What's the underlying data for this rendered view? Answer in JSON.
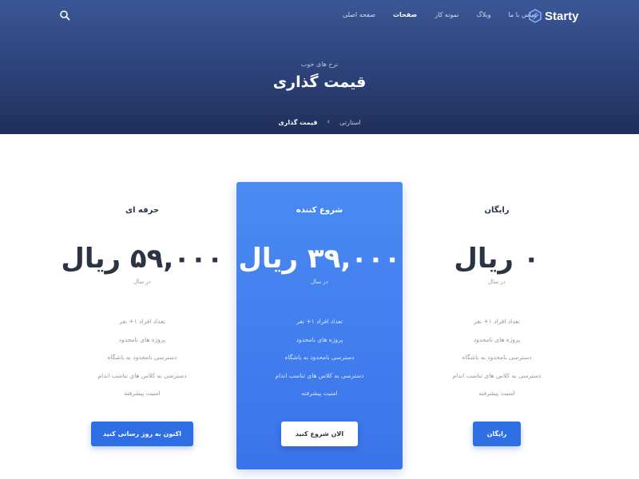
{
  "brand": {
    "name": "Starty",
    "icon": "starty-logo-icon"
  },
  "nav": {
    "search_icon": "search-icon",
    "items": [
      {
        "label": "صفحه اصلی",
        "active": false
      },
      {
        "label": "صفحات",
        "active": true
      },
      {
        "label": "نمونه کار",
        "active": false
      },
      {
        "label": "وبلاگ",
        "active": false
      },
      {
        "label": "تماس با ما",
        "active": false
      }
    ]
  },
  "hero": {
    "subtitle": "نرخ های خوب",
    "title": "قیمت گذاری",
    "breadcrumb": {
      "home": "استارتی",
      "separator": "›",
      "current": "قیمت گذاری"
    }
  },
  "plans": [
    {
      "name": "رایگان",
      "price": "۰ ریال",
      "period": "در سال",
      "features": [
        "تعداد افراد ۱+ نفر",
        "پروژه های نامحدود",
        "دسترسی نامحدود به باشگاه",
        "دسترسی به کلاس های تناسب اندام",
        "امنیت پیشرفته"
      ],
      "button": "رایگان",
      "featured": false
    },
    {
      "name": "شروع کننده",
      "price": "۳۹,۰۰۰ ریال",
      "period": "در سال",
      "features": [
        "تعداد افراد ۱+ نفر",
        "پروژه های نامحدود",
        "دسترسی نامحدود به باشگاه",
        "دسترسی به کلاس های تناسب اندام",
        "امنیت پیشرفته"
      ],
      "button": "الان شروع کنید",
      "featured": true
    },
    {
      "name": "حرفه ای",
      "price": "۵۹,۰۰۰ ریال",
      "period": "در سال",
      "features": [
        "تعداد افراد ۱+ نفر",
        "پروژه های نامحدود",
        "دسترسی نامحدود به باشگاه",
        "دسترسی به کلاس های تناسب اندام",
        "امنیت پیشرفته"
      ],
      "button": "اکنون به روز رسانی کنید",
      "featured": false
    }
  ],
  "colors": {
    "hero_top": "#3c5796",
    "hero_bottom": "#1f2f5a",
    "featured_card": "#4a8bf2",
    "primary_button": "#2f6fe4",
    "heading_text": "#2b3445",
    "muted_text": "#8f96a3"
  }
}
